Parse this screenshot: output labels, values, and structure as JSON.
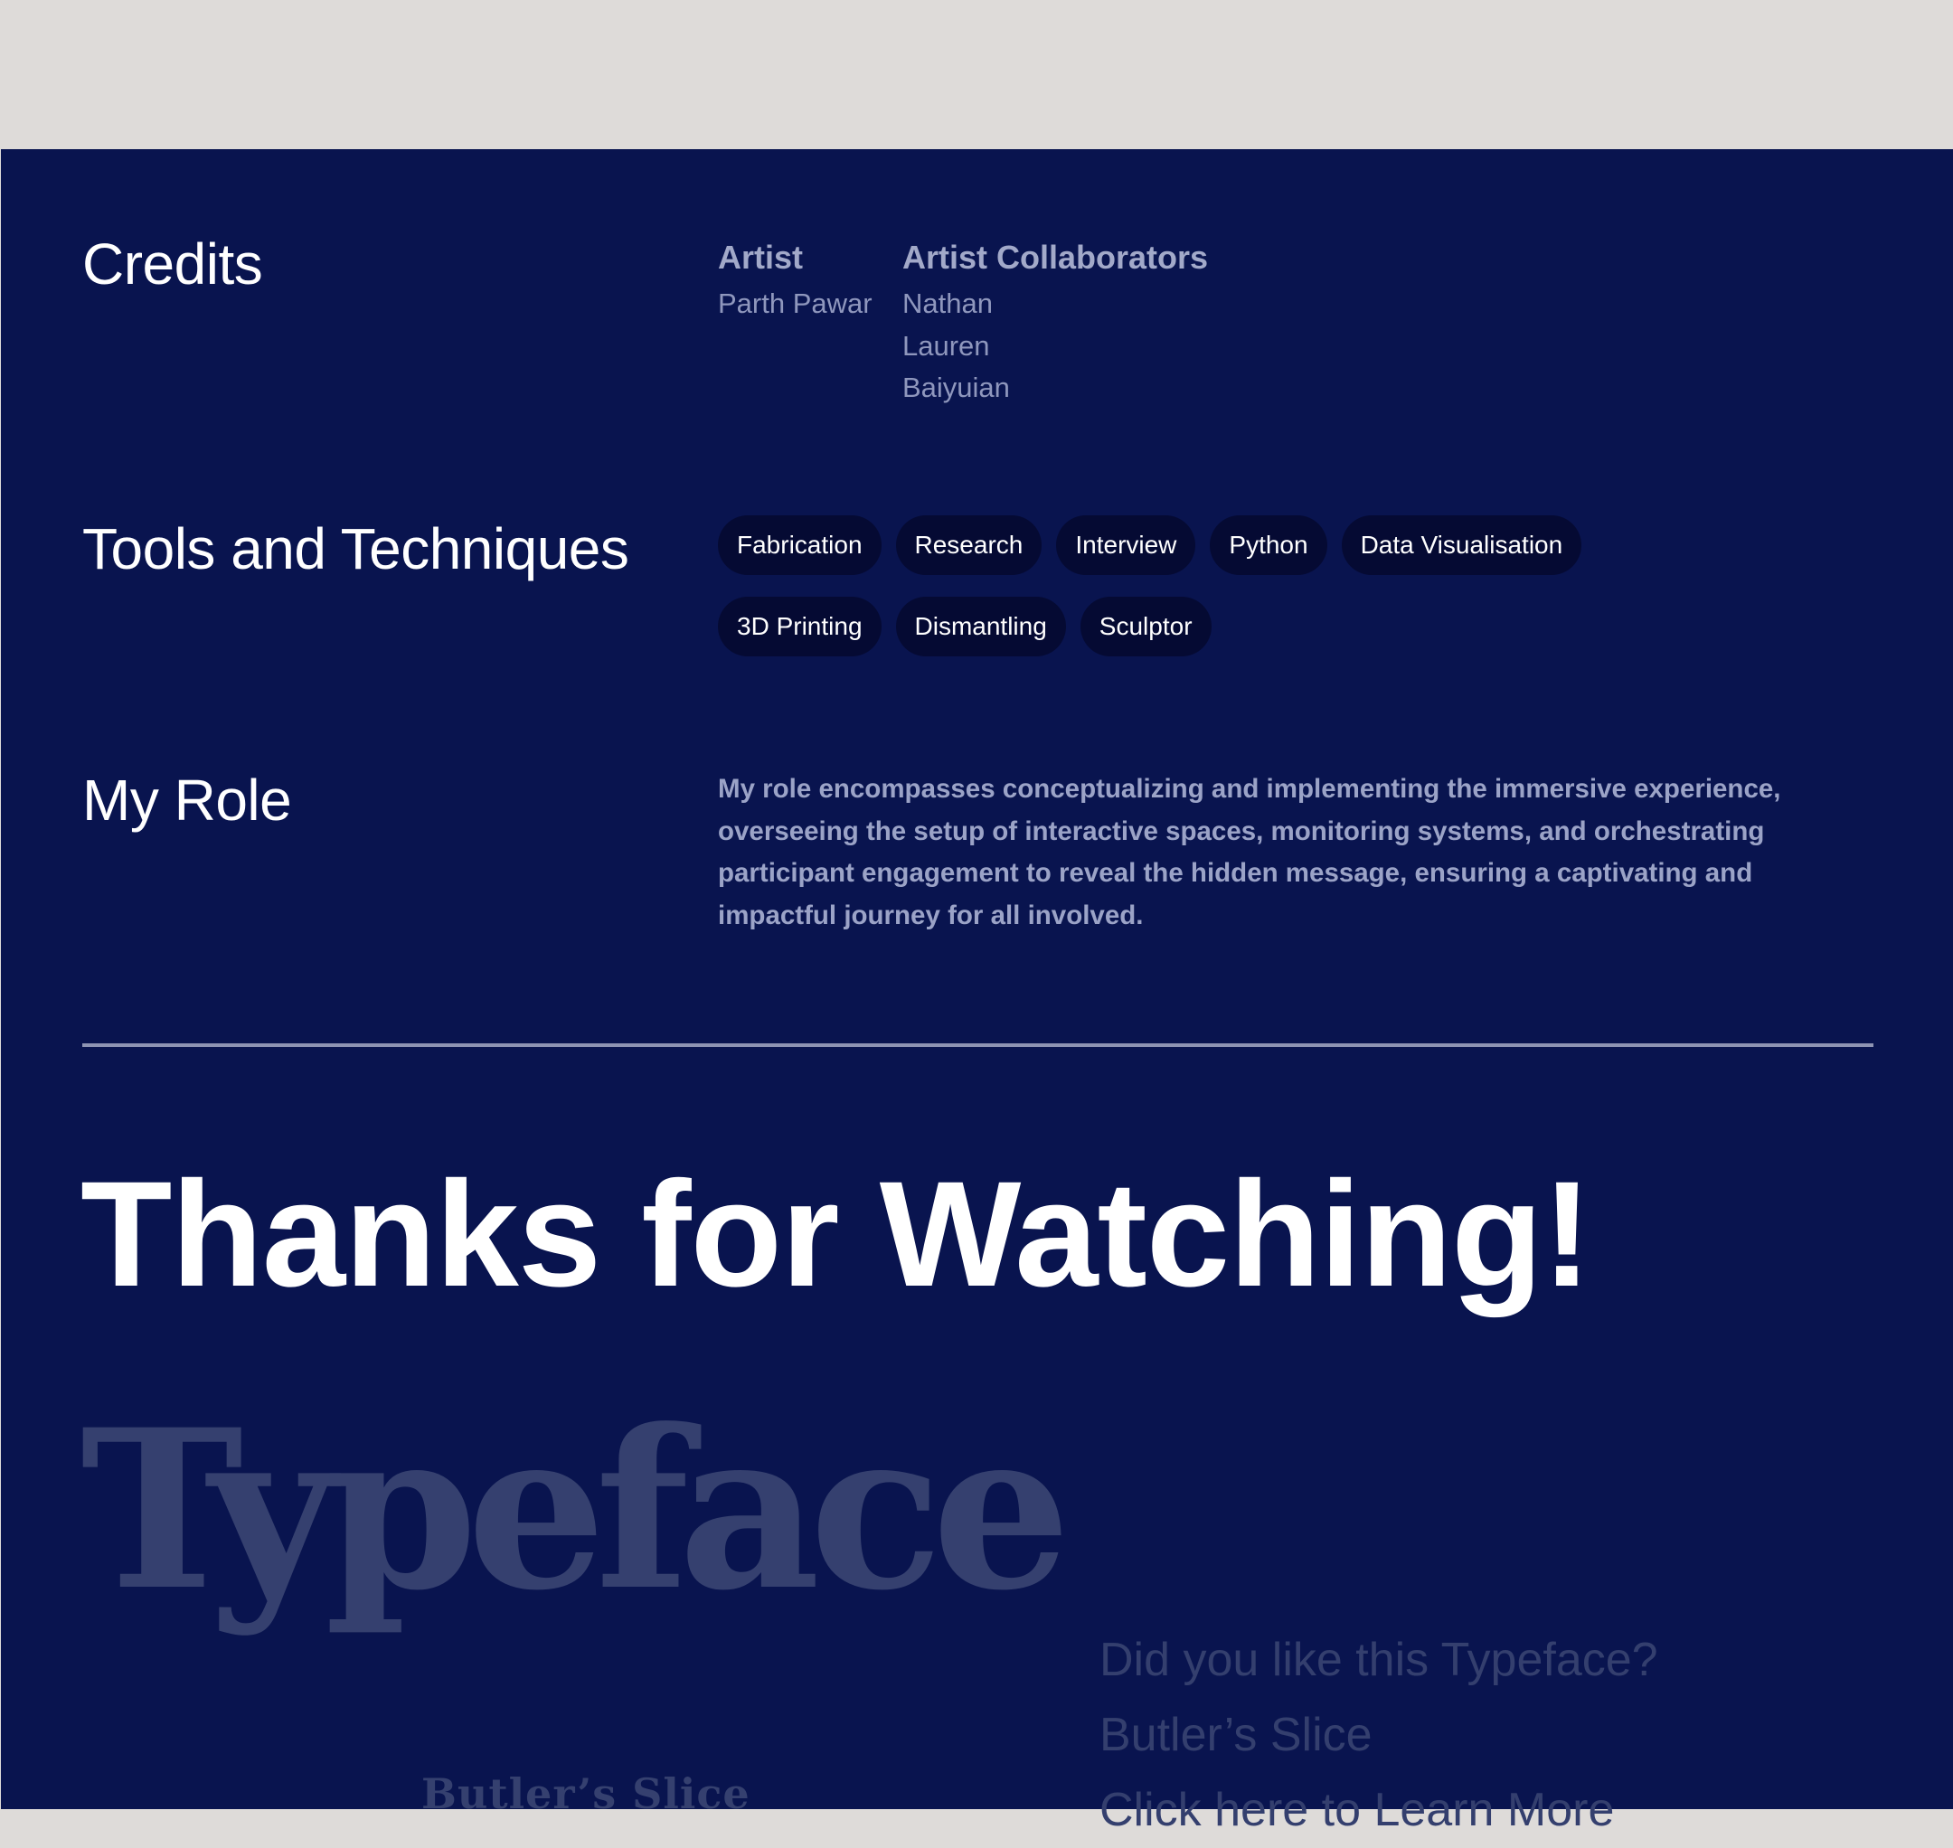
{
  "credits": {
    "heading": "Credits",
    "artist_label": "Artist",
    "artist_name": "Parth Pawar",
    "collaborators_label": "Artist Collaborators",
    "collaborators": [
      "Nathan",
      "Lauren",
      "Baiyuian"
    ]
  },
  "tools": {
    "heading": "Tools and Techniques",
    "tags_row1": [
      "Fabrication",
      "Research",
      "Interview",
      "Python",
      "Data Visualisation"
    ],
    "tags_row2": [
      "3D Printing",
      "Dismantling",
      "Sculptor"
    ]
  },
  "role": {
    "heading": "My Role",
    "text": "My role encompasses conceptualizing and implementing the immersive experience, overseeing the setup of interactive spaces, monitoring systems, and orchestrating participant engagement to reveal the hidden message, ensuring a captivating and impactful journey for all involved."
  },
  "thanks": "Thanks for Watching!",
  "typeface": {
    "logo_word": "Typeface",
    "logo_sub": "Butler’s Slice",
    "question": "Did you like this Typeface?",
    "name": "Butler’s Slice",
    "link_label": "Click here to Learn More"
  },
  "colors": {
    "background_top": "#dedbd9",
    "panel": "#09144f",
    "chip": "#050a33",
    "heading": "#ffffff",
    "muted_text": "#9ba3c7",
    "faded": "#35406f"
  }
}
